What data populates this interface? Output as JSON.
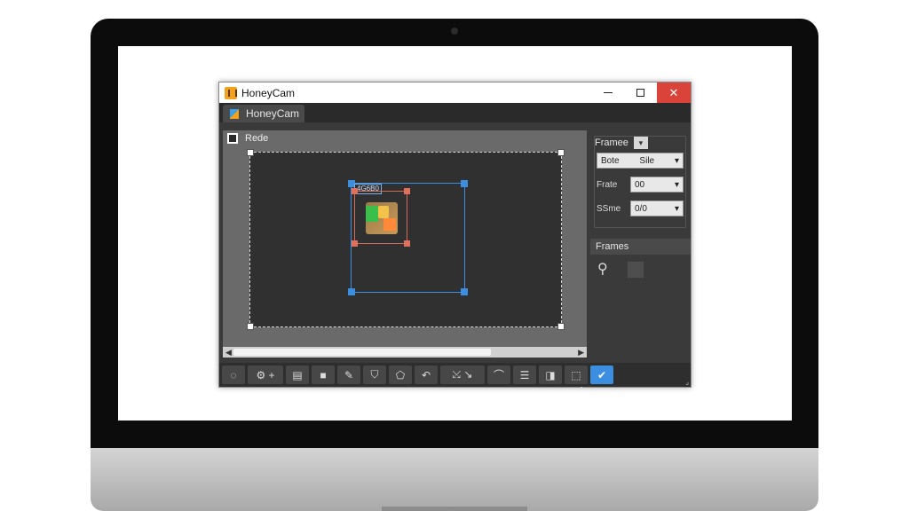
{
  "window": {
    "title": "HoneyCam",
    "controls": {
      "minimize": "",
      "maximize": "",
      "close": "✕"
    }
  },
  "tabs": [
    {
      "label": "HoneyCam",
      "active": true
    }
  ],
  "canvas": {
    "title": "Rede",
    "selection_label": "4G6B0"
  },
  "right_panel": {
    "frame_group": {
      "header": "Framee",
      "dropdown_arrow": "▾",
      "fields": [
        {
          "label": "Bote",
          "value": "Sile"
        },
        {
          "label": "Frate",
          "value": "00"
        },
        {
          "label": "SSme",
          "value": "0/0"
        }
      ]
    },
    "frames_header": "Frames"
  },
  "toolbar": {
    "buttons": [
      {
        "name": "record-toggle",
        "glyph": "◌"
      },
      {
        "name": "add-frames",
        "glyph": "⚙ +"
      },
      {
        "name": "document",
        "glyph": "▤"
      },
      {
        "name": "rectangle",
        "glyph": "■"
      },
      {
        "name": "pen",
        "glyph": "✎"
      },
      {
        "name": "shield",
        "glyph": "⛉"
      },
      {
        "name": "polygon",
        "glyph": "⬠"
      },
      {
        "name": "undo",
        "glyph": "↶"
      },
      {
        "name": "crop",
        "glyph": "⤩ ↘"
      },
      {
        "name": "arch",
        "glyph": "⌒"
      },
      {
        "name": "equalizer",
        "glyph": "☰"
      },
      {
        "name": "palette",
        "glyph": "◨"
      },
      {
        "name": "export",
        "glyph": "⬚"
      },
      {
        "name": "confirm",
        "glyph": "✔"
      }
    ]
  },
  "colors": {
    "accent": "#3b8ee0",
    "close_button": "#d9433a",
    "handle_red": "#e0705e"
  }
}
